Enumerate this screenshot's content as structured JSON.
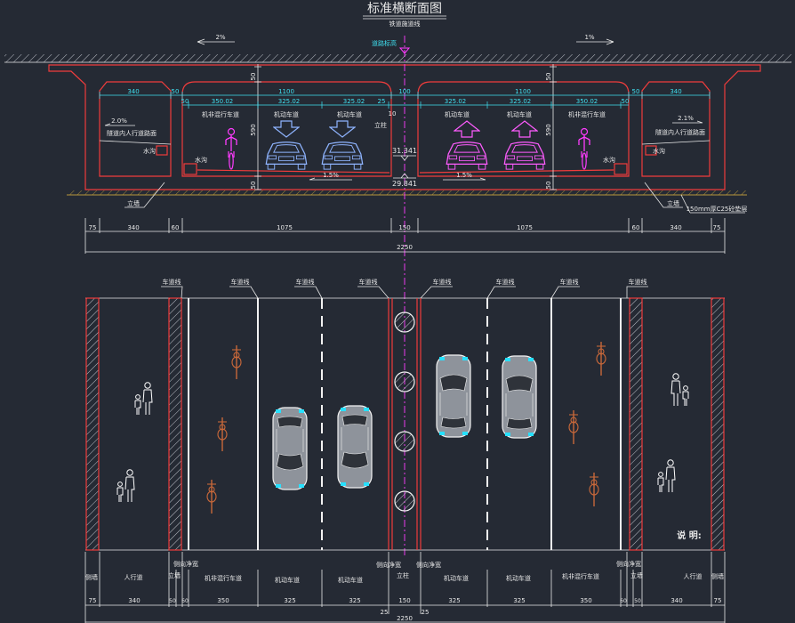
{
  "title": "标准横断面图",
  "top_label": "铁道施道线",
  "road_elevation": "道路标高",
  "slope_top_left": "2%",
  "slope_top_right": "1%",
  "section": {
    "row1": [
      "340",
      "50",
      "1100",
      "100",
      "1100",
      "50",
      "340"
    ],
    "row2": [
      "50",
      "350.02",
      "325.02",
      "325.02",
      "25",
      "325.02",
      "325.02",
      "350.02",
      "50"
    ],
    "lanes": [
      "机非混行车道",
      "机动车道",
      "机动车道",
      "机动车道",
      "机动车道",
      "机非混行车道"
    ],
    "center_dim": "10",
    "center_column": "立柱",
    "sidewalk_slope_left": "2.0%",
    "sidewalk_slope_right": "2.1%",
    "sidewalk_surface": "隧道内人行道路面",
    "drain": "水沟",
    "wall": "立墙",
    "cushion": "150mm厚C25砼垫层",
    "elev_road": "31.341",
    "elev_base": "29.841",
    "road_slope": "1.5%",
    "vertical_dims": [
      "50",
      "590",
      "50"
    ],
    "bottom_dims": [
      "75",
      "340",
      "60",
      "1075",
      "150",
      "1075",
      "60",
      "340",
      "75"
    ],
    "total": "2250"
  },
  "plan": {
    "lane_line": "车道线",
    "notes_title": "说 明:",
    "labels": [
      "侧墙",
      "人行道",
      "侧向净宽",
      "立墙",
      "机非混行车道",
      "机动车道",
      "机动车道",
      "侧向净宽",
      "立柱",
      "侧向净宽",
      "机动车道",
      "机动车道",
      "机非混行车道",
      "侧向净宽",
      "立墙",
      "人行道",
      "侧墙"
    ],
    "dims": [
      "75",
      "340",
      "50",
      "60",
      "350",
      "325",
      "325",
      "150",
      "325",
      "325",
      "350",
      "60",
      "50",
      "340",
      "75"
    ],
    "half_offset": "25",
    "total": "2250"
  },
  "colors": {
    "background": "#252a34",
    "structure": "#f03c3c",
    "dimension": "#3fe0f0",
    "centerline": "#ff3cff",
    "car_down": "#8fb4ff",
    "car_up": "#ff5cff",
    "cyclist_plan": "#c8683a"
  }
}
